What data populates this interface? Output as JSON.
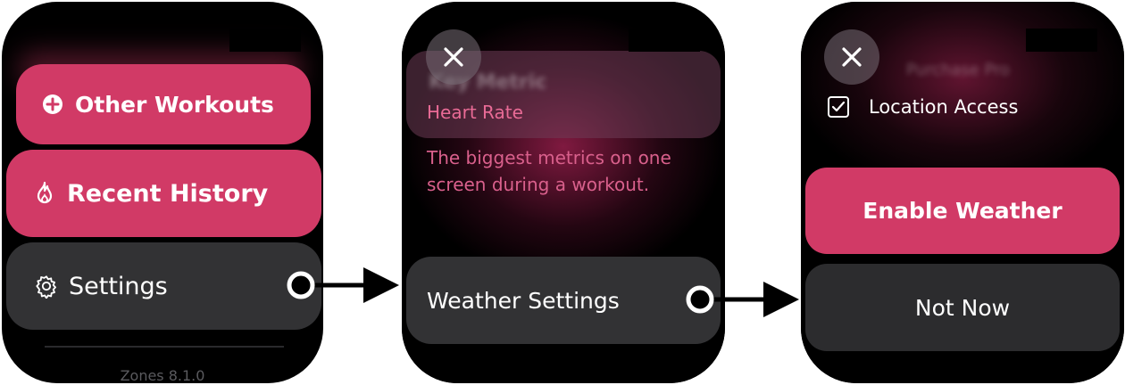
{
  "screens": [
    {
      "menu": {
        "other_workouts": "Other Workouts",
        "recent_history": "Recent History",
        "settings": "Settings"
      },
      "version": "Zones 8.1.0"
    },
    {
      "card_title": "Key Metric",
      "card_value": "Heart Rate",
      "description": "The biggest metrics on one screen during a workout.",
      "button": "Weather Settings"
    },
    {
      "blurred_text": "Purchase Pro",
      "checkbox_label": "Location Access",
      "checkbox_checked": true,
      "primary_button": "Enable Weather",
      "secondary_button": "Not Now"
    }
  ],
  "colors": {
    "accent": "#d13a66",
    "accent_text": "#e96b96",
    "button_gray": "#323234",
    "watch_bg": "#000000"
  },
  "icons": [
    "plus-circle-icon",
    "flame-icon",
    "gear-icon",
    "close-icon",
    "checkbox-icon",
    "arrow-icon"
  ]
}
